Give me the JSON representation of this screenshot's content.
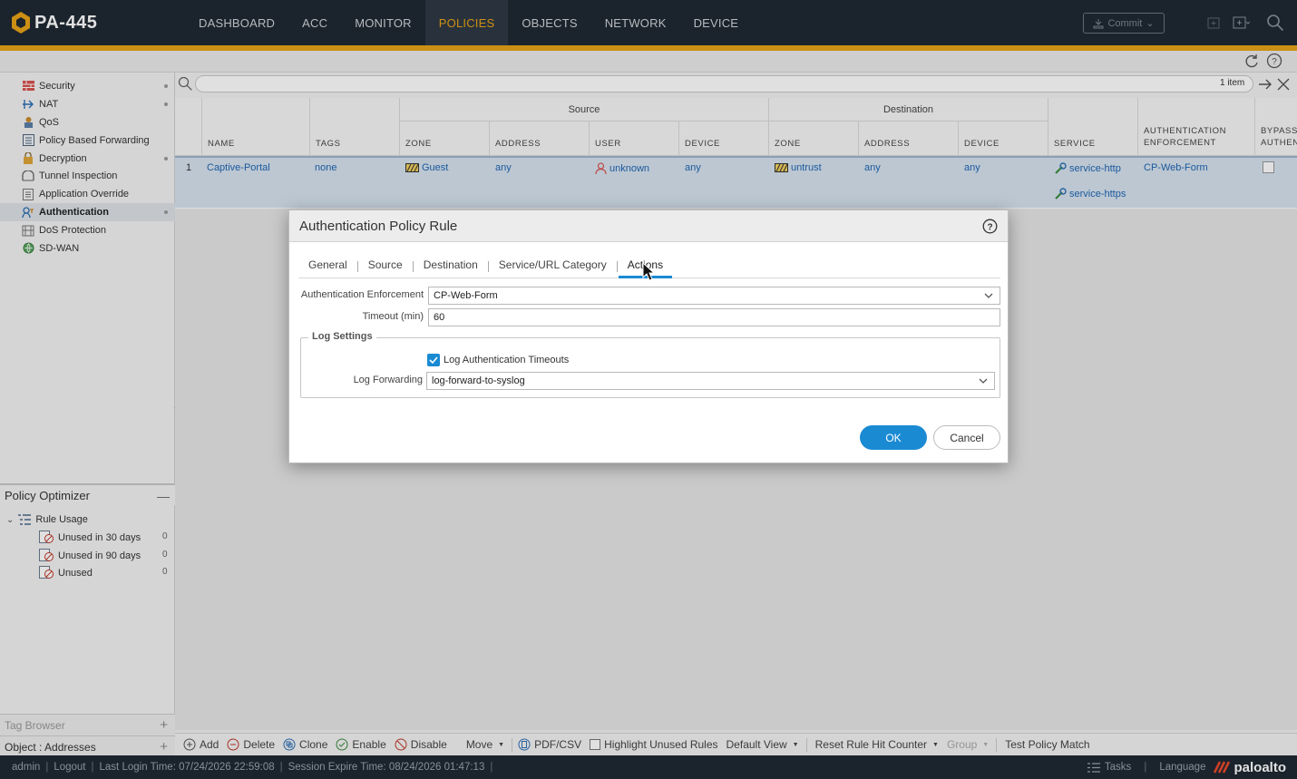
{
  "app": {
    "device_name": "PA-445",
    "nav": [
      "DASHBOARD",
      "ACC",
      "MONITOR",
      "POLICIES",
      "OBJECTS",
      "NETWORK",
      "DEVICE"
    ],
    "active_nav": "POLICIES",
    "commit_label": "Commit",
    "accent": "#e8a317",
    "topbar_color": "#1f2833"
  },
  "sidebar": {
    "policies": [
      {
        "label": "Security",
        "icon": "security-rule-icon"
      },
      {
        "label": "NAT",
        "icon": "nat-icon"
      },
      {
        "label": "QoS",
        "icon": "qos-icon"
      },
      {
        "label": "Policy Based Forwarding",
        "icon": "pbf-icon"
      },
      {
        "label": "Decryption",
        "icon": "lock-icon"
      },
      {
        "label": "Tunnel Inspection",
        "icon": "tunnel-icon"
      },
      {
        "label": "Application Override",
        "icon": "app-override-icon"
      },
      {
        "label": "Authentication",
        "icon": "authentication-icon"
      },
      {
        "label": "DoS Protection",
        "icon": "dos-icon"
      },
      {
        "label": "SD-WAN",
        "icon": "sdwan-icon"
      }
    ],
    "active": "Authentication",
    "optimizer": {
      "title": "Policy Optimizer",
      "rule_usage": "Rule Usage",
      "items": [
        {
          "label": "Unused in 30 days",
          "count": "0"
        },
        {
          "label": "Unused in 90 days",
          "count": "0"
        },
        {
          "label": "Unused",
          "count": "0"
        }
      ]
    },
    "tag_browser": "Tag Browser",
    "object_addresses": "Object : Addresses"
  },
  "search": {
    "placeholder": "",
    "item_count": "1 item"
  },
  "table": {
    "group_source": "Source",
    "group_destination": "Destination",
    "headers": {
      "name": "NAME",
      "tags": "TAGS",
      "src_zone": "ZONE",
      "src_address": "ADDRESS",
      "src_user": "USER",
      "src_device": "DEVICE",
      "dst_zone": "ZONE",
      "dst_address": "ADDRESS",
      "dst_device": "DEVICE",
      "service": "SERVICE",
      "auth_enf": "AUTHENTICATION ENFORCEMENT",
      "bypass": "BYPASS AUTHEN"
    },
    "row": {
      "num": "1",
      "name": "Captive-Portal",
      "tags": "none",
      "src_zone": "Guest",
      "src_address": "any",
      "src_user": "unknown",
      "src_device": "any",
      "dst_zone": "untrust",
      "dst_address": "any",
      "dst_device": "any",
      "service_1": "service-http",
      "service_2": "service-https",
      "auth_enf": "CP-Web-Form"
    }
  },
  "modal": {
    "title": "Authentication Policy Rule",
    "tabs": [
      "General",
      "Source",
      "Destination",
      "Service/URL Category",
      "Actions"
    ],
    "active_tab": "Actions",
    "auth_enf_label": "Authentication Enforcement",
    "auth_enf_value": "CP-Web-Form",
    "timeout_label": "Timeout (min)",
    "timeout_value": "60",
    "log_settings_label": "Log Settings",
    "log_auth_timeouts_label": "Log Authentication Timeouts",
    "log_auth_timeouts_checked": true,
    "log_forwarding_label": "Log Forwarding",
    "log_forwarding_value": "log-forward-to-syslog",
    "ok_label": "OK",
    "cancel_label": "Cancel",
    "ok_color": "#1a8ad3"
  },
  "toolbar": {
    "add": "Add",
    "delete": "Delete",
    "clone": "Clone",
    "enable": "Enable",
    "disable": "Disable",
    "move": "Move",
    "pdf_csv": "PDF/CSV",
    "highlight_unused": "Highlight Unused Rules",
    "default_view": "Default View",
    "reset_hit": "Reset Rule Hit Counter",
    "group": "Group",
    "test_policy": "Test Policy Match"
  },
  "status": {
    "user": "admin",
    "logout": "Logout",
    "last_login": "Last Login Time: 07/24/2026 22:59:08",
    "session_expire": "Session Expire Time: 08/24/2026 01:47:13",
    "tasks": "Tasks",
    "language": "Language",
    "brand": "paloalto"
  }
}
